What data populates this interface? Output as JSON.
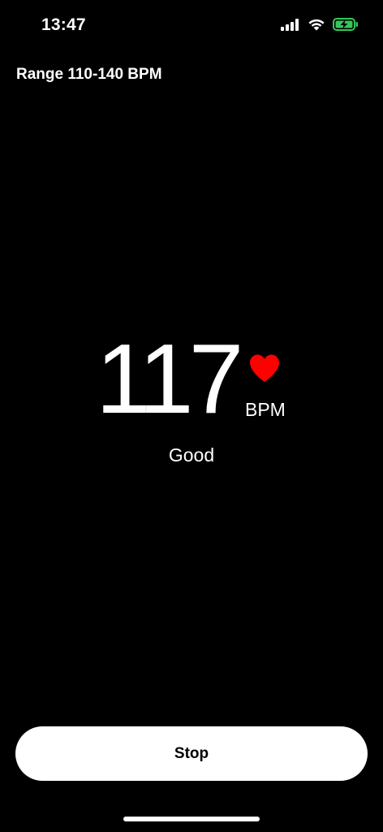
{
  "status_bar": {
    "time": "13:47",
    "icons": [
      "cellular-signal-icon",
      "wifi-icon",
      "battery-charging-icon"
    ],
    "battery_color": "#34c759"
  },
  "range": {
    "label": "Range 110-140 BPM"
  },
  "reading": {
    "value": "117",
    "unit": "BPM",
    "status": "Good",
    "heart_color": "#ff0000"
  },
  "actions": {
    "stop_label": "Stop"
  }
}
